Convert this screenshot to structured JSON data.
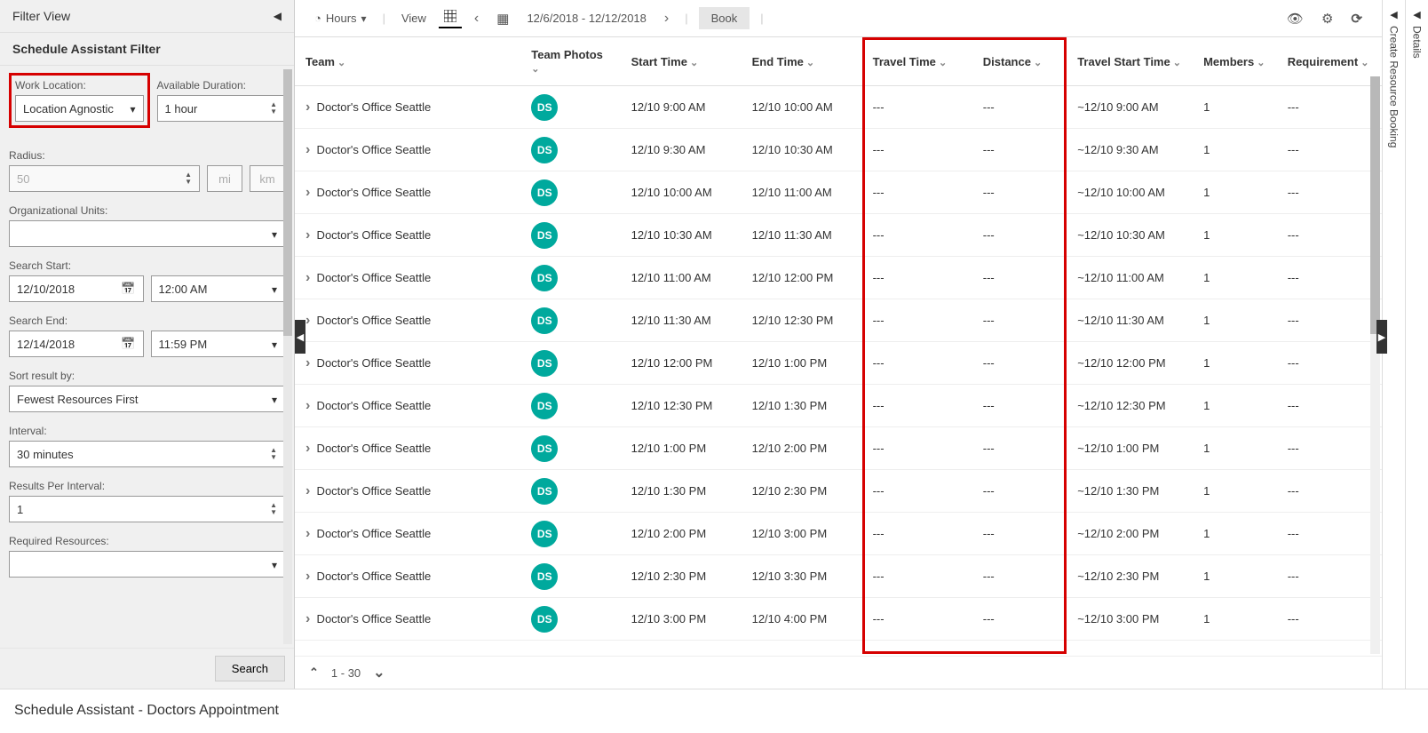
{
  "filter": {
    "header": "Filter View",
    "subheader": "Schedule Assistant Filter",
    "work_location": {
      "label": "Work Location:",
      "value": "Location Agnostic"
    },
    "available_duration": {
      "label": "Available Duration:",
      "value": "1 hour"
    },
    "radius": {
      "label": "Radius:",
      "value": "50",
      "unit_mi": "mi",
      "unit_km": "km"
    },
    "org_units": {
      "label": "Organizational Units:",
      "value": ""
    },
    "search_start": {
      "label": "Search Start:",
      "date": "12/10/2018",
      "time": "12:00 AM"
    },
    "search_end": {
      "label": "Search End:",
      "date": "12/14/2018",
      "time": "11:59 PM"
    },
    "sort_by": {
      "label": "Sort result by:",
      "value": "Fewest Resources First"
    },
    "interval": {
      "label": "Interval:",
      "value": "30 minutes"
    },
    "results_per_interval": {
      "label": "Results Per Interval:",
      "value": "1"
    },
    "required_resources": {
      "label": "Required Resources:",
      "value": ""
    },
    "search_button": "Search"
  },
  "toolbar": {
    "hours": "Hours",
    "view": "View",
    "date_range": "12/6/2018 - 12/12/2018",
    "book": "Book"
  },
  "columns": [
    "Team",
    "Team Photos",
    "Start Time",
    "End Time",
    "Travel Time",
    "Distance",
    "Travel Start Time",
    "Members",
    "Requirement"
  ],
  "rows": [
    {
      "team": "Doctor's Office Seattle",
      "photo": "DS",
      "start": "12/10 9:00 AM",
      "end": "12/10 10:00 AM",
      "travel": "---",
      "dist": "---",
      "tstart": "~12/10 9:00 AM",
      "members": "1",
      "req": "---"
    },
    {
      "team": "Doctor's Office Seattle",
      "photo": "DS",
      "start": "12/10 9:30 AM",
      "end": "12/10 10:30 AM",
      "travel": "---",
      "dist": "---",
      "tstart": "~12/10 9:30 AM",
      "members": "1",
      "req": "---"
    },
    {
      "team": "Doctor's Office Seattle",
      "photo": "DS",
      "start": "12/10 10:00 AM",
      "end": "12/10 11:00 AM",
      "travel": "---",
      "dist": "---",
      "tstart": "~12/10 10:00 AM",
      "members": "1",
      "req": "---"
    },
    {
      "team": "Doctor's Office Seattle",
      "photo": "DS",
      "start": "12/10 10:30 AM",
      "end": "12/10 11:30 AM",
      "travel": "---",
      "dist": "---",
      "tstart": "~12/10 10:30 AM",
      "members": "1",
      "req": "---"
    },
    {
      "team": "Doctor's Office Seattle",
      "photo": "DS",
      "start": "12/10 11:00 AM",
      "end": "12/10 12:00 PM",
      "travel": "---",
      "dist": "---",
      "tstart": "~12/10 11:00 AM",
      "members": "1",
      "req": "---"
    },
    {
      "team": "Doctor's Office Seattle",
      "photo": "DS",
      "start": "12/10 11:30 AM",
      "end": "12/10 12:30 PM",
      "travel": "---",
      "dist": "---",
      "tstart": "~12/10 11:30 AM",
      "members": "1",
      "req": "---"
    },
    {
      "team": "Doctor's Office Seattle",
      "photo": "DS",
      "start": "12/10 12:00 PM",
      "end": "12/10 1:00 PM",
      "travel": "---",
      "dist": "---",
      "tstart": "~12/10 12:00 PM",
      "members": "1",
      "req": "---"
    },
    {
      "team": "Doctor's Office Seattle",
      "photo": "DS",
      "start": "12/10 12:30 PM",
      "end": "12/10 1:30 PM",
      "travel": "---",
      "dist": "---",
      "tstart": "~12/10 12:30 PM",
      "members": "1",
      "req": "---"
    },
    {
      "team": "Doctor's Office Seattle",
      "photo": "DS",
      "start": "12/10 1:00 PM",
      "end": "12/10 2:00 PM",
      "travel": "---",
      "dist": "---",
      "tstart": "~12/10 1:00 PM",
      "members": "1",
      "req": "---"
    },
    {
      "team": "Doctor's Office Seattle",
      "photo": "DS",
      "start": "12/10 1:30 PM",
      "end": "12/10 2:30 PM",
      "travel": "---",
      "dist": "---",
      "tstart": "~12/10 1:30 PM",
      "members": "1",
      "req": "---"
    },
    {
      "team": "Doctor's Office Seattle",
      "photo": "DS",
      "start": "12/10 2:00 PM",
      "end": "12/10 3:00 PM",
      "travel": "---",
      "dist": "---",
      "tstart": "~12/10 2:00 PM",
      "members": "1",
      "req": "---"
    },
    {
      "team": "Doctor's Office Seattle",
      "photo": "DS",
      "start": "12/10 2:30 PM",
      "end": "12/10 3:30 PM",
      "travel": "---",
      "dist": "---",
      "tstart": "~12/10 2:30 PM",
      "members": "1",
      "req": "---"
    },
    {
      "team": "Doctor's Office Seattle",
      "photo": "DS",
      "start": "12/10 3:00 PM",
      "end": "12/10 4:00 PM",
      "travel": "---",
      "dist": "---",
      "tstart": "~12/10 3:00 PM",
      "members": "1",
      "req": "---"
    }
  ],
  "pager": {
    "text": "1 - 30"
  },
  "right_rails": {
    "details": "Details",
    "create_booking": "Create Resource Booking"
  },
  "status_bar": "Schedule Assistant - Doctors Appointment"
}
